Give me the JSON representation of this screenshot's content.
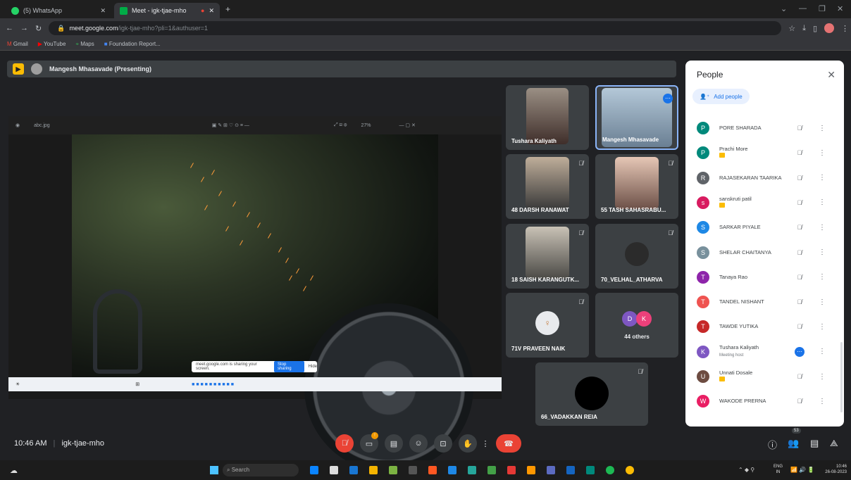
{
  "browser": {
    "tabs": [
      {
        "label": "(5) WhatsApp",
        "color": "#25d366"
      },
      {
        "label": "Meet - igk-tjae-mho",
        "color": "#00ac47"
      }
    ],
    "new_tab": "+",
    "url_host": "meet.google.com",
    "url_path": "/igk-tjae-mho?pli=1&authuser=1",
    "bookmarks": [
      "Gmail",
      "YouTube",
      "Maps",
      "Foundation Report..."
    ]
  },
  "meet": {
    "presenter_label": "Mangesh Mhasavade (Presenting)",
    "meeting_time": "10:46 AM",
    "meeting_code": "igk-tjae-mho",
    "participant_count": "53"
  },
  "viewer": {
    "filename": "abc.jpg",
    "zoom": "27%"
  },
  "share_popup": {
    "text": "meet.google.com is sharing your screen.",
    "stop": "Stop sharing",
    "hide": "Hide"
  },
  "tiles": [
    {
      "name": "Tushara Kaliyath"
    },
    {
      "name": "Mangesh Mhasavade"
    },
    {
      "name": "48 DARSH RANAWAT"
    },
    {
      "name": "55 TASH SAHASRABU..."
    },
    {
      "name": "18 SAISH KARANGUTK..."
    },
    {
      "name": "70_VELHAL_ATHARVA"
    },
    {
      "name": "71V PRAVEEN NAIK"
    },
    {
      "name": "44 others",
      "avatars": [
        "D",
        "K"
      ]
    },
    {
      "name": "66_VADAKKAN REIA"
    }
  ],
  "people": {
    "title": "People",
    "add": "Add people",
    "list": [
      {
        "initial": "P",
        "name": "PORE SHARADA",
        "color": "#00897b",
        "sub": ""
      },
      {
        "initial": "P",
        "name": "Prachi More",
        "color": "#00897b",
        "sub": ""
      },
      {
        "initial": "R",
        "name": "RAJASEKARAN TAARIKA",
        "color": "#5f6368",
        "sub": ""
      },
      {
        "initial": "s",
        "name": "sanskruti patil",
        "color": "#d81b60",
        "sub": ""
      },
      {
        "initial": "S",
        "name": "SARKAR PIYALE",
        "color": "#1e88e5",
        "sub": ""
      },
      {
        "initial": "S",
        "name": "SHELAR CHAITANYA",
        "color": "#78909c",
        "sub": ""
      },
      {
        "initial": "T",
        "name": "Tanaya Rao",
        "color": "#8e24aa",
        "sub": ""
      },
      {
        "initial": "T",
        "name": "TANDEL NISHANT",
        "color": "#ef5350",
        "sub": ""
      },
      {
        "initial": "T",
        "name": "TAWDE YUTIKA",
        "color": "#c62828",
        "sub": ""
      },
      {
        "initial": "K",
        "name": "Tushara Kaliyath",
        "color": "#7e57c2",
        "sub": "Meeting host"
      },
      {
        "initial": "U",
        "name": "Unnati Dosale",
        "color": "#6d4c41",
        "sub": ""
      },
      {
        "initial": "W",
        "name": "WAKODE PRERNA",
        "color": "#e91e63",
        "sub": ""
      }
    ]
  },
  "taskbar": {
    "search": "Search",
    "lang": "ENG",
    "region": "IN",
    "clock_time": "10:46",
    "clock_date": "26-08-2023"
  }
}
